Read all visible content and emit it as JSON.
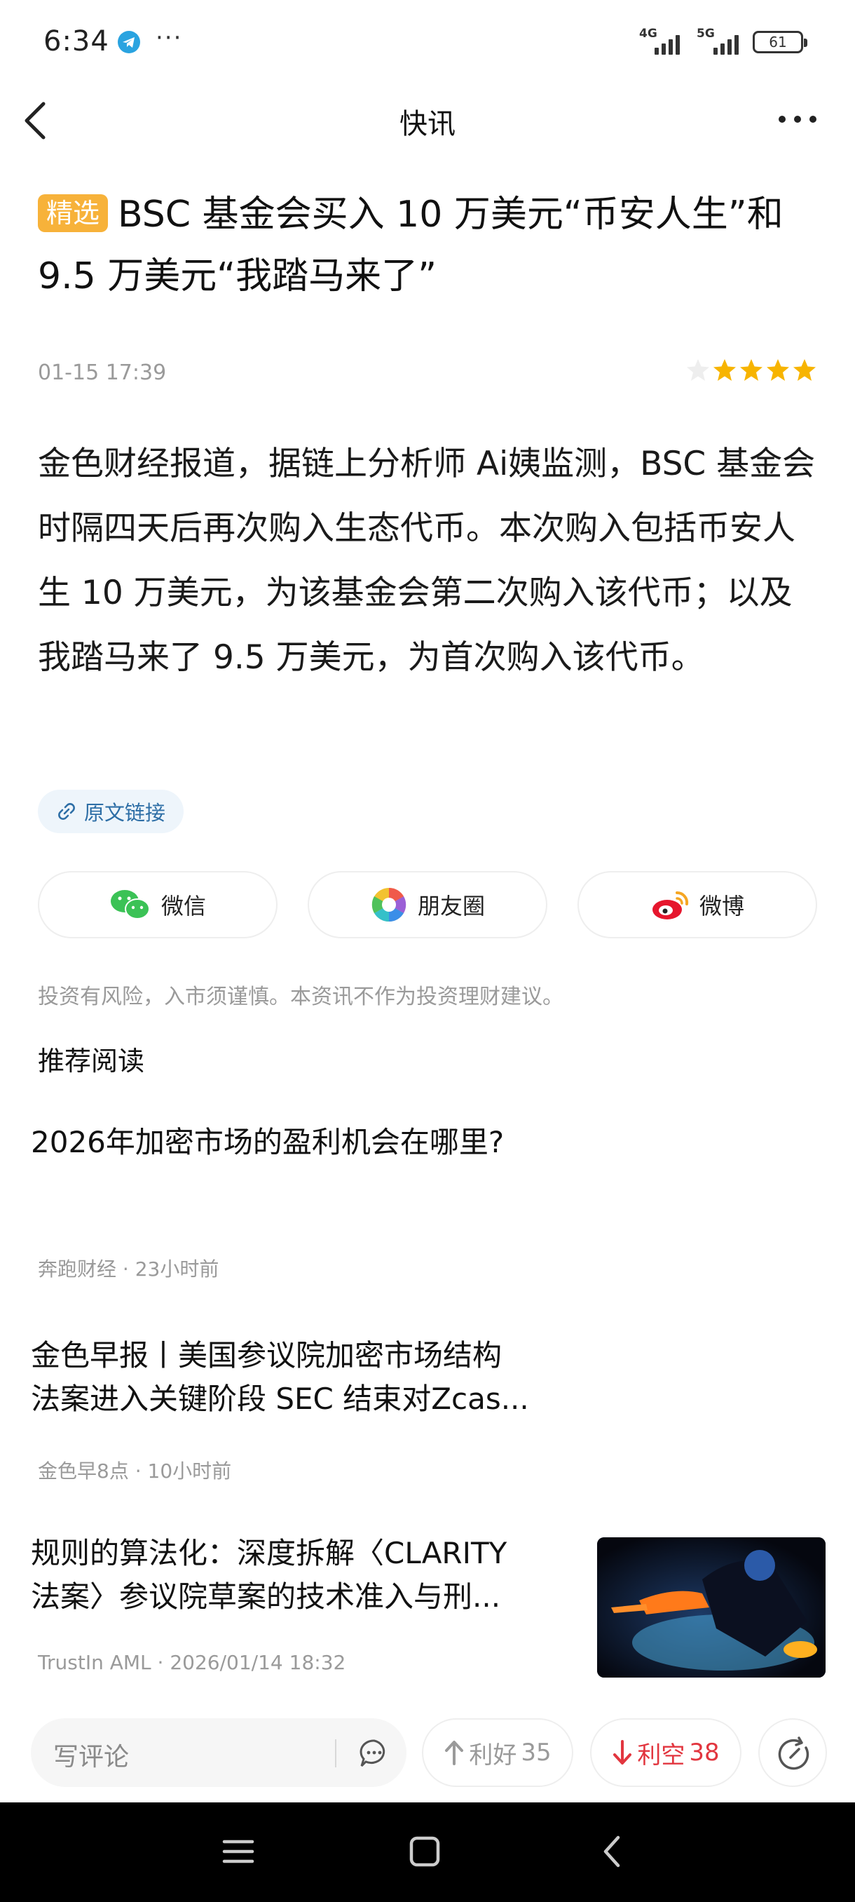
{
  "status_bar": {
    "time": "6:34",
    "sig1": "4G",
    "sig2": "5G",
    "battery": "61"
  },
  "nav": {
    "title": "快讯"
  },
  "headline": {
    "badge": "精选",
    "title": "BSC 基金会买入 10 万美元“币安人生”和 9.5 万美元“我踏马来了”"
  },
  "meta": {
    "date": "01-15  17:39",
    "rating": 4,
    "rating_max": 5
  },
  "body": "金色财经报道，据链上分析师 Ai姨监测，BSC 基金会时隔四天后再次购入生态代币。本次购入包括币安人生 10 万美元，为该基金会第二次购入该代币；以及我踏马来了 9.5 万美元，为首次购入该代币。",
  "source_link": {
    "label": "原文链接"
  },
  "share": [
    {
      "label": "微信",
      "icon": "wechat-icon"
    },
    {
      "label": "朋友圈",
      "icon": "moments-icon"
    },
    {
      "label": "微博",
      "icon": "weibo-icon"
    }
  ],
  "disclaimer": "投资有风险，入市须谨慎。本资讯不作为投资理财建议。",
  "recommend": {
    "title": "推荐阅读",
    "articles": [
      {
        "title_lines": [
          "2026年加密市场的盈利机会在哪里?"
        ],
        "source": "奔跑财经",
        "time": "23小时前"
      },
      {
        "title_lines": [
          "金色早报丨美国参议院加密市场结构",
          "法案进入关键阶段 SEC 结束对Zcas..."
        ],
        "source": "金色早8点",
        "time": "10小时前"
      },
      {
        "title_lines": [
          "规则的算法化：深度拆解〈CLARITY",
          "法案〉参议院草案的技术准入与刑..."
        ],
        "source": "TrustIn AML",
        "time": "2026/01/14 18:32"
      }
    ]
  },
  "actions": {
    "comment_placeholder": "写评论",
    "bullish_label": "利好",
    "bullish_count": "35",
    "bearish_label": "利空",
    "bearish_count": "38"
  },
  "colors": {
    "accent_gold": "#f7b23a",
    "star": "#f7b400",
    "bearish": "#e2363f",
    "bullish_gray": "#9a9a9a",
    "link": "#2d6ea6"
  }
}
